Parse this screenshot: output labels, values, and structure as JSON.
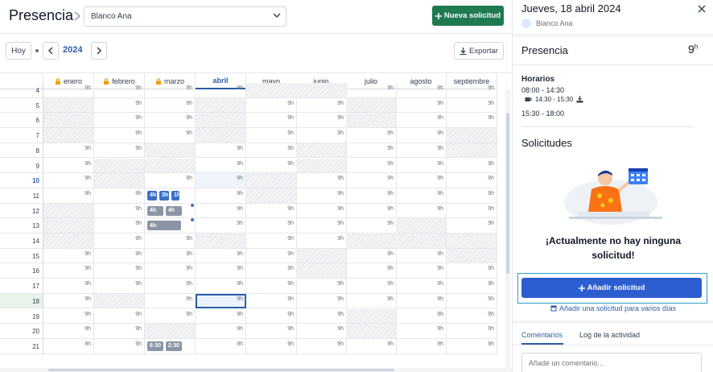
{
  "header": {
    "title": "Presencia",
    "person": "Blanco Ana",
    "new_request": "Nueva solicitud"
  },
  "toolbar": {
    "today": "Hoy",
    "year": "2024",
    "export": "Exportar"
  },
  "calendar": {
    "months": [
      {
        "label": "enero",
        "locked": true
      },
      {
        "label": "febrero",
        "locked": true
      },
      {
        "label": "marzo",
        "locked": true
      },
      {
        "label": "abril",
        "locked": false,
        "current": true
      },
      {
        "label": "mayo",
        "locked": false
      },
      {
        "label": "junio",
        "locked": false
      },
      {
        "label": "julio",
        "locked": false
      },
      {
        "label": "agosto",
        "locked": false
      },
      {
        "label": "septiembre",
        "locked": false
      }
    ],
    "rows": [
      {
        "day": "4",
        "cells": [
          "9h",
          "9h",
          "9h",
          "9h",
          "we",
          "we",
          "9h",
          "9h",
          "9h"
        ]
      },
      {
        "day": "5",
        "cells": [
          "we",
          "9h",
          "9h",
          "we",
          "9h",
          "9h",
          "we",
          "9h",
          "9h"
        ]
      },
      {
        "day": "6",
        "cells": [
          "we",
          "9h",
          "9h",
          "we",
          "9h",
          "9h",
          "we",
          "9h",
          "9h"
        ]
      },
      {
        "day": "7",
        "cells": [
          "we",
          "9h",
          "9h",
          "we",
          "9h",
          "9h",
          "9h",
          "9h",
          "we"
        ]
      },
      {
        "day": "8",
        "cells": [
          "9h",
          "9h",
          "we",
          "9h",
          "9h",
          "we",
          "9h",
          "9h",
          "we"
        ]
      },
      {
        "day": "9",
        "cells": [
          "9h",
          "we",
          "we",
          "9h",
          "9h",
          "we",
          "9h",
          "9h",
          "9h"
        ]
      },
      {
        "day": "10",
        "cells": [
          "9h",
          "we",
          "9h",
          "9h",
          "we",
          "9h",
          "9h",
          "9h",
          "9h"
        ]
      },
      {
        "day": "11",
        "cells": [
          "9h",
          "9h",
          "ev",
          "9h",
          "we",
          "9h",
          "9h",
          "9h",
          "9h"
        ]
      },
      {
        "day": "12",
        "cells": [
          "we",
          "9h",
          "ev",
          "9h",
          "9h",
          "9h",
          "9h",
          "9h",
          "9h"
        ]
      },
      {
        "day": "13",
        "cells": [
          "we",
          "9h",
          "ev",
          "9h",
          "9h",
          "9h",
          "9h",
          "we",
          "9h"
        ]
      },
      {
        "day": "14",
        "cells": [
          "we",
          "9h",
          "9h",
          "we",
          "9h",
          "9h",
          "we",
          "we",
          "we"
        ]
      },
      {
        "day": "15",
        "cells": [
          "9h",
          "9h",
          "9h",
          "9h",
          "9h",
          "we",
          "9h",
          "9h",
          "we"
        ]
      },
      {
        "day": "16",
        "cells": [
          "9h",
          "9h",
          "9h",
          "9h",
          "9h",
          "we",
          "9h",
          "9h",
          "9h"
        ]
      },
      {
        "day": "17",
        "cells": [
          "9h",
          "9h",
          "9h",
          "9h",
          "9h",
          "9h",
          "9h",
          "9h",
          "9h"
        ]
      },
      {
        "day": "18",
        "cells": [
          "9h",
          "we",
          "9h",
          "9h",
          "9h",
          "9h",
          "9h",
          "9h",
          "9h"
        ]
      },
      {
        "day": "19",
        "cells": [
          "9h",
          "9h",
          "9h",
          "9h",
          "9h",
          "9h",
          "we",
          "9h",
          "9h"
        ]
      },
      {
        "day": "20",
        "cells": [
          "9h",
          "9h",
          "we",
          "9h",
          "9h",
          "9h",
          "we",
          "9h",
          "9h"
        ]
      },
      {
        "day": "21",
        "cells": [
          "9h",
          "9h",
          "ev",
          "9h",
          "9h",
          "9h",
          "9h",
          "9h",
          "9h"
        ]
      }
    ],
    "today_day": "10",
    "selected_day": "18",
    "events": [
      {
        "day": "11",
        "items": [
          "4h",
          "3h",
          "1h"
        ],
        "color": "blue"
      },
      {
        "day": "12",
        "items": [
          "4h",
          "4h"
        ],
        "color": "gray"
      },
      {
        "day": "13",
        "items": [
          "4h"
        ],
        "color": "gray"
      },
      {
        "day": "21",
        "items": [
          "6:30",
          "2:30"
        ],
        "color": "gray"
      }
    ]
  },
  "panel": {
    "date": "Jueves, 18 abril 2024",
    "user": "Blanco Ana",
    "presence_title": "Presencia",
    "presence_hours": "9",
    "presence_unit": "h",
    "horarios_title": "Horarios",
    "range1": "08:00 - 14:30",
    "break": "14:30 - 15:30",
    "range2": "15:30 - 18:00",
    "solicitudes_title": "Solicitudes",
    "empty_msg": "¡Actualmente no hay ninguna solicitud!",
    "add_button": "Añadir solicitud",
    "add_multi": "Añadir una solicitud para varios días",
    "tab_comments": "Comentarios",
    "tab_log": "Log de la actividad",
    "comment_placeholder": "Añade un comentario..."
  }
}
